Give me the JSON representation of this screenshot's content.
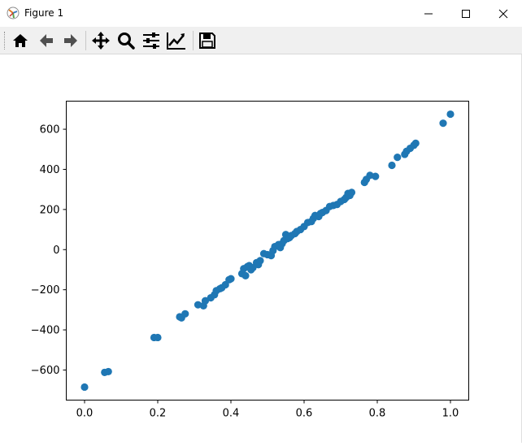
{
  "window": {
    "title": "Figure 1",
    "controls": [
      "minimize",
      "maximize",
      "close"
    ]
  },
  "toolbar": {
    "buttons": [
      {
        "name": "home",
        "icon": "home-icon"
      },
      {
        "name": "back",
        "icon": "arrow-left-icon"
      },
      {
        "name": "forward",
        "icon": "arrow-right-icon"
      },
      {
        "name": "pan",
        "icon": "move-icon"
      },
      {
        "name": "zoom",
        "icon": "magnifier-icon"
      },
      {
        "name": "subplots",
        "icon": "sliders-icon"
      },
      {
        "name": "edit-axes",
        "icon": "line-chart-icon"
      },
      {
        "name": "save",
        "icon": "floppy-disk-icon"
      }
    ]
  },
  "chart_data": {
    "type": "scatter",
    "title": "",
    "xlabel": "",
    "ylabel": "",
    "xlim": [
      -0.05,
      1.05
    ],
    "ylim": [
      -750,
      740
    ],
    "xticks": [
      0.0,
      0.2,
      0.4,
      0.6,
      0.8,
      1.0
    ],
    "xtick_labels": [
      "0.0",
      "0.2",
      "0.4",
      "0.6",
      "0.8",
      "1.0"
    ],
    "yticks": [
      -600,
      -400,
      -200,
      0,
      200,
      400,
      600
    ],
    "ytick_labels": [
      "−600",
      "−400",
      "−200",
      "0",
      "200",
      "400",
      "600"
    ],
    "marker_color": "#1f77b4",
    "grid": false,
    "series": [
      {
        "points": [
          [
            0.0,
            -685
          ],
          [
            0.055,
            -612
          ],
          [
            0.065,
            -608
          ],
          [
            0.19,
            -438
          ],
          [
            0.2,
            -438
          ],
          [
            0.26,
            -335
          ],
          [
            0.265,
            -340
          ],
          [
            0.275,
            -320
          ],
          [
            0.31,
            -275
          ],
          [
            0.325,
            -280
          ],
          [
            0.33,
            -255
          ],
          [
            0.345,
            -240
          ],
          [
            0.355,
            -225
          ],
          [
            0.36,
            -205
          ],
          [
            0.37,
            -195
          ],
          [
            0.375,
            -190
          ],
          [
            0.385,
            -175
          ],
          [
            0.395,
            -150
          ],
          [
            0.4,
            -145
          ],
          [
            0.43,
            -120
          ],
          [
            0.435,
            -95
          ],
          [
            0.44,
            -130
          ],
          [
            0.445,
            -85
          ],
          [
            0.45,
            -80
          ],
          [
            0.455,
            -100
          ],
          [
            0.46,
            -90
          ],
          [
            0.47,
            -65
          ],
          [
            0.475,
            -75
          ],
          [
            0.48,
            -55
          ],
          [
            0.49,
            -20
          ],
          [
            0.5,
            -25
          ],
          [
            0.51,
            -30
          ],
          [
            0.515,
            -5
          ],
          [
            0.52,
            15
          ],
          [
            0.53,
            25
          ],
          [
            0.535,
            10
          ],
          [
            0.54,
            30
          ],
          [
            0.545,
            45
          ],
          [
            0.55,
            75
          ],
          [
            0.555,
            55
          ],
          [
            0.56,
            60
          ],
          [
            0.565,
            70
          ],
          [
            0.575,
            80
          ],
          [
            0.58,
            90
          ],
          [
            0.59,
            100
          ],
          [
            0.6,
            115
          ],
          [
            0.61,
            135
          ],
          [
            0.62,
            140
          ],
          [
            0.625,
            155
          ],
          [
            0.63,
            170
          ],
          [
            0.64,
            165
          ],
          [
            0.645,
            180
          ],
          [
            0.65,
            185
          ],
          [
            0.66,
            195
          ],
          [
            0.67,
            215
          ],
          [
            0.68,
            220
          ],
          [
            0.69,
            225
          ],
          [
            0.7,
            240
          ],
          [
            0.71,
            250
          ],
          [
            0.715,
            260
          ],
          [
            0.72,
            280
          ],
          [
            0.725,
            270
          ],
          [
            0.73,
            285
          ],
          [
            0.765,
            335
          ],
          [
            0.77,
            350
          ],
          [
            0.78,
            370
          ],
          [
            0.795,
            365
          ],
          [
            0.84,
            420
          ],
          [
            0.855,
            460
          ],
          [
            0.875,
            475
          ],
          [
            0.88,
            490
          ],
          [
            0.89,
            505
          ],
          [
            0.9,
            520
          ],
          [
            0.905,
            530
          ],
          [
            0.98,
            630
          ],
          [
            1.0,
            675
          ]
        ]
      }
    ]
  }
}
